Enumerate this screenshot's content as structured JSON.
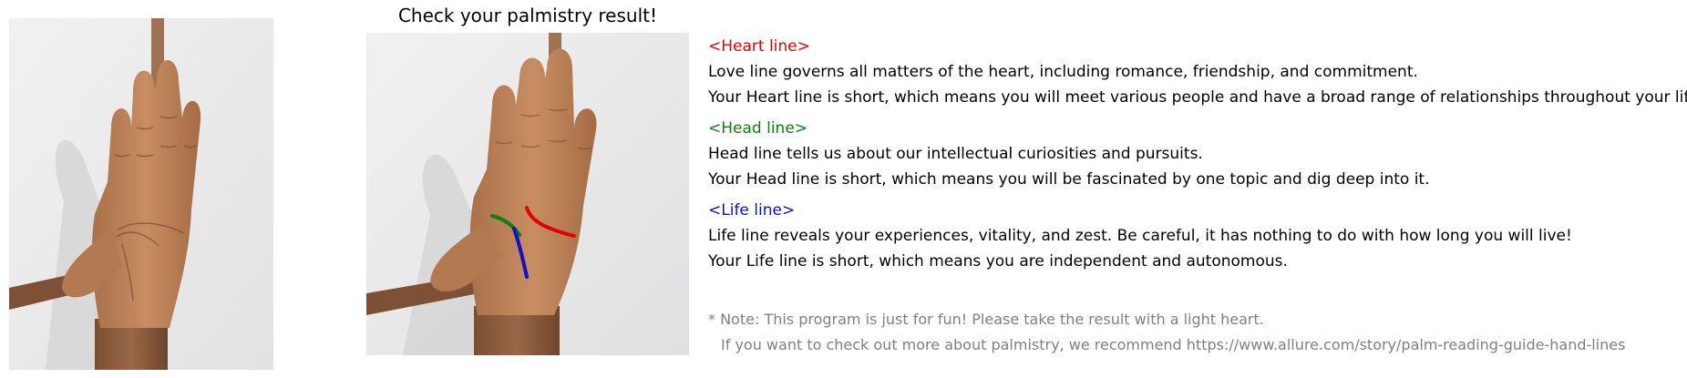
{
  "title": "Check your palmistry result!",
  "lines": [
    {
      "heading": "<Heart line>",
      "color": "#e30000",
      "description": "Love line governs all matters of the heart, including romance, friendship, and commitment.",
      "result": "Your Heart line is short, which means you will meet various people and have a broad range of relationships throughout your life."
    },
    {
      "heading": "<Head line>",
      "color": "#0f7d0f",
      "description": "Head line tells us about our intellectual curiosities and pursuits.",
      "result": "Your Head line is short, which means you will be fascinated by one topic and dig deep into it."
    },
    {
      "heading": "<Life line>",
      "color": "#1010c8",
      "description": "Life line reveals your experiences, vitality, and zest. Be careful, it has nothing to do with how long you will live!",
      "result": "Your Life line is short, which means you are independent and autonomous."
    }
  ],
  "note": "* Note: This program is just for fun! Please take the result with a light heart.",
  "recommendation": "If you want to check out more about palmistry, we recommend https://www.allure.com/story/palm-reading-guide-hand-lines",
  "images": {
    "left": "original palm photo",
    "right": "palm photo with detected lines"
  }
}
